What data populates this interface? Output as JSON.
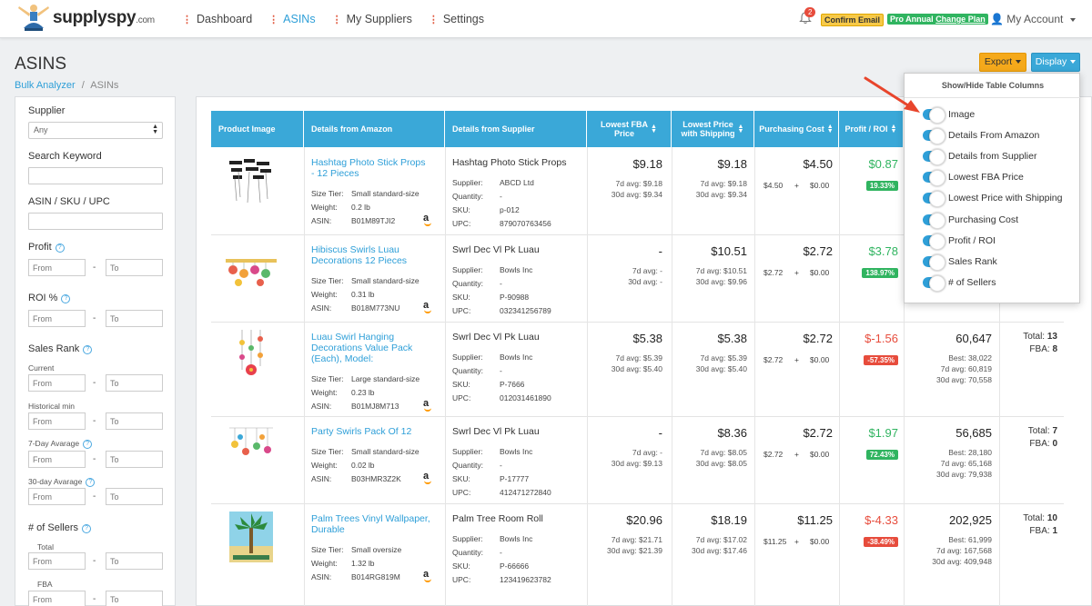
{
  "header": {
    "brand": "supplyspy",
    "brand_domain": ".com",
    "nav": [
      {
        "label": "Dashboard"
      },
      {
        "label": "ASINs"
      },
      {
        "label": "My Suppliers"
      },
      {
        "label": "Settings"
      }
    ],
    "notification_count": "2",
    "confirm_email": "Confirm Email",
    "plan": "Pro Annual",
    "plan_change": "Change Plan",
    "account": "My Account"
  },
  "page": {
    "title": "ASINS",
    "breadcrumb_parent": "Bulk Analyzer",
    "breadcrumb_sep": "/",
    "breadcrumb_current": "ASINs",
    "export_label": "Export",
    "display_label": "Display"
  },
  "sidebar": {
    "supplier_label": "Supplier",
    "supplier_value": "Any",
    "search_keyword_label": "Search Keyword",
    "asin_label": "ASIN / SKU / UPC",
    "profit_label": "Profit",
    "roi_label": "ROI %",
    "sales_rank_label": "Sales Rank",
    "current_label": "Current",
    "historical_min_label": "Historical min",
    "seven_day_label": "7-Day Avarage",
    "thirty_day_label": "30-day Avarage",
    "sellers_label": "# of Sellers",
    "total_label": "Total",
    "fba_label": "FBA",
    "from_placeholder": "From",
    "to_placeholder": "To",
    "range_dash": "-",
    "help_glyph": "?"
  },
  "table": {
    "headers": {
      "image": "Product Image",
      "amazon": "Details from Amazon",
      "supplier": "Details from Supplier",
      "lowest_fba_1": "Lowest FBA",
      "lowest_fba_2": "Price",
      "lowest_ship_1": "Lowest Price",
      "lowest_ship_2": "with Shipping",
      "purchasing": "Purchasing Cost",
      "profit": "Profit / ROI"
    },
    "keys": {
      "size_tier": "Size Tier:",
      "weight": "Weight:",
      "asin": "ASIN:",
      "supplier": "Supplier:",
      "quantity": "Quantity:",
      "sku": "SKU:",
      "upc": "UPC:",
      "plus": "+",
      "total": "Total:",
      "fba": "FBA:"
    },
    "rows": [
      {
        "title_1": "Hashtag Photo Stick Props",
        "title_2": "- 12 Pieces",
        "title_3": "",
        "size_tier": "Small standard-size",
        "weight": "0.2 lb",
        "asin": "B01M89TJI2",
        "supplier_name": "Hashtag Photo Stick Props",
        "supplier": "ABCD Ltd",
        "quantity": "-",
        "sku": "p-012",
        "upc": "879070763456",
        "fba_price": "$9.18",
        "fba_7d": "7d avg: $9.18",
        "fba_30d": "30d avg: $9.34",
        "ship_price": "$9.18",
        "ship_7d": "7d avg: $9.18",
        "ship_30d": "30d avg: $9.34",
        "cost": "$4.50",
        "cost_base": "$4.50",
        "cost_add": "$0.00",
        "profit": "$0.87",
        "roi": "19.33%",
        "positive": true,
        "rank": "",
        "rank_best": "",
        "rank_7d": "",
        "rank_30d": "",
        "sellers_total": "",
        "sellers_fba": ""
      },
      {
        "title_1": "Hibiscus Swirls Luau",
        "title_2": "Decorations 12 Pieces",
        "title_3": "",
        "size_tier": "Small standard-size",
        "weight": "0.31 lb",
        "asin": "B018M773NU",
        "supplier_name": "Swrl Dec Vl Pk Luau",
        "supplier": "Bowls Inc",
        "quantity": "-",
        "sku": "P-90988",
        "upc": "032341256789",
        "fba_price": "-",
        "fba_7d": "7d avg: -",
        "fba_30d": "30d avg: -",
        "ship_price": "$10.51",
        "ship_7d": "7d avg: $10.51",
        "ship_30d": "30d avg: $9.96",
        "cost": "$2.72",
        "cost_base": "$2.72",
        "cost_add": "$0.00",
        "profit": "$3.78",
        "roi": "138.97%",
        "positive": true,
        "rank": "",
        "rank_best": "",
        "rank_7d": "",
        "rank_30d": "",
        "sellers_total": "",
        "sellers_fba": ""
      },
      {
        "title_1": "Luau Swirl Hanging",
        "title_2": "Decorations Value Pack",
        "title_3": "(Each), Model:",
        "size_tier": "Large standard-size",
        "weight": "0.23 lb",
        "asin": "B01MJ8M713",
        "supplier_name": "Swrl Dec Vl Pk Luau",
        "supplier": "Bowls Inc",
        "quantity": "-",
        "sku": "P-7666",
        "upc": "012031461890",
        "fba_price": "$5.38",
        "fba_7d": "7d avg: $5.39",
        "fba_30d": "30d avg: $5.40",
        "ship_price": "$5.38",
        "ship_7d": "7d avg: $5.39",
        "ship_30d": "30d avg: $5.40",
        "cost": "$2.72",
        "cost_base": "$2.72",
        "cost_add": "$0.00",
        "profit": "$-1.56",
        "roi": "-57.35%",
        "positive": false,
        "rank": "60,647",
        "rank_best": "Best: 38,022",
        "rank_7d": "7d avg: 60,819",
        "rank_30d": "30d avg: 70,558",
        "sellers_total": "13",
        "sellers_fba": "8"
      },
      {
        "title_1": "Party Swirls Pack Of 12",
        "title_2": "",
        "title_3": "",
        "size_tier": "Small standard-size",
        "weight": "0.02 lb",
        "asin": "B03HMR3Z2K",
        "supplier_name": "Swrl Dec Vl Pk Luau",
        "supplier": "Bowls Inc",
        "quantity": "-",
        "sku": "P-17777",
        "upc": "412471272840",
        "fba_price": "-",
        "fba_7d": "7d avg: -",
        "fba_30d": "30d avg: $9.13",
        "ship_price": "$8.36",
        "ship_7d": "7d avg: $8.05",
        "ship_30d": "30d avg: $8.05",
        "cost": "$2.72",
        "cost_base": "$2.72",
        "cost_add": "$0.00",
        "profit": "$1.97",
        "roi": "72.43%",
        "positive": true,
        "rank": "56,685",
        "rank_best": "Best: 28,180",
        "rank_7d": "7d avg: 65,168",
        "rank_30d": "30d avg: 79,938",
        "sellers_total": "7",
        "sellers_fba": "0"
      },
      {
        "title_1": "Palm Trees Vinyl Wallpaper,",
        "title_2": "Durable",
        "title_3": "",
        "size_tier": "Small oversize",
        "weight": "1.32 lb",
        "asin": "B014RG819M",
        "supplier_name": "Palm Tree Room Roll",
        "supplier": "Bowls Inc",
        "quantity": "-",
        "sku": "P-66666",
        "upc": "123419623782",
        "fba_price": "$20.96",
        "fba_7d": "7d avg: $21.71",
        "fba_30d": "30d avg: $21.39",
        "ship_price": "$18.19",
        "ship_7d": "7d avg: $17.02",
        "ship_30d": "30d avg: $17.46",
        "cost": "$11.25",
        "cost_base": "$11.25",
        "cost_add": "$0.00",
        "profit": "$-4.33",
        "roi": "-38.49%",
        "positive": false,
        "rank": "202,925",
        "rank_best": "Best: 61,999",
        "rank_7d": "7d avg: 167,568",
        "rank_30d": "30d avg: 409,948",
        "sellers_total": "10",
        "sellers_fba": "1"
      }
    ]
  },
  "dropdown": {
    "title": "Show/Hide Table Columns",
    "items": [
      {
        "label": "Image"
      },
      {
        "label": "Details From Amazon"
      },
      {
        "label": "Details from Supplier"
      },
      {
        "label": "Lowest FBA Price"
      },
      {
        "label": "Lowest Price with Shipping"
      },
      {
        "label": "Purchasing Cost"
      },
      {
        "label": "Profit / ROI"
      },
      {
        "label": "Sales Rank"
      },
      {
        "label": "# of Sellers"
      }
    ]
  },
  "colors": {
    "accent": "#3aa8d8",
    "positive": "#30b460",
    "negative": "#e74c3c",
    "export": "#f5a91b",
    "annotation_arrow": "#e8452c"
  }
}
